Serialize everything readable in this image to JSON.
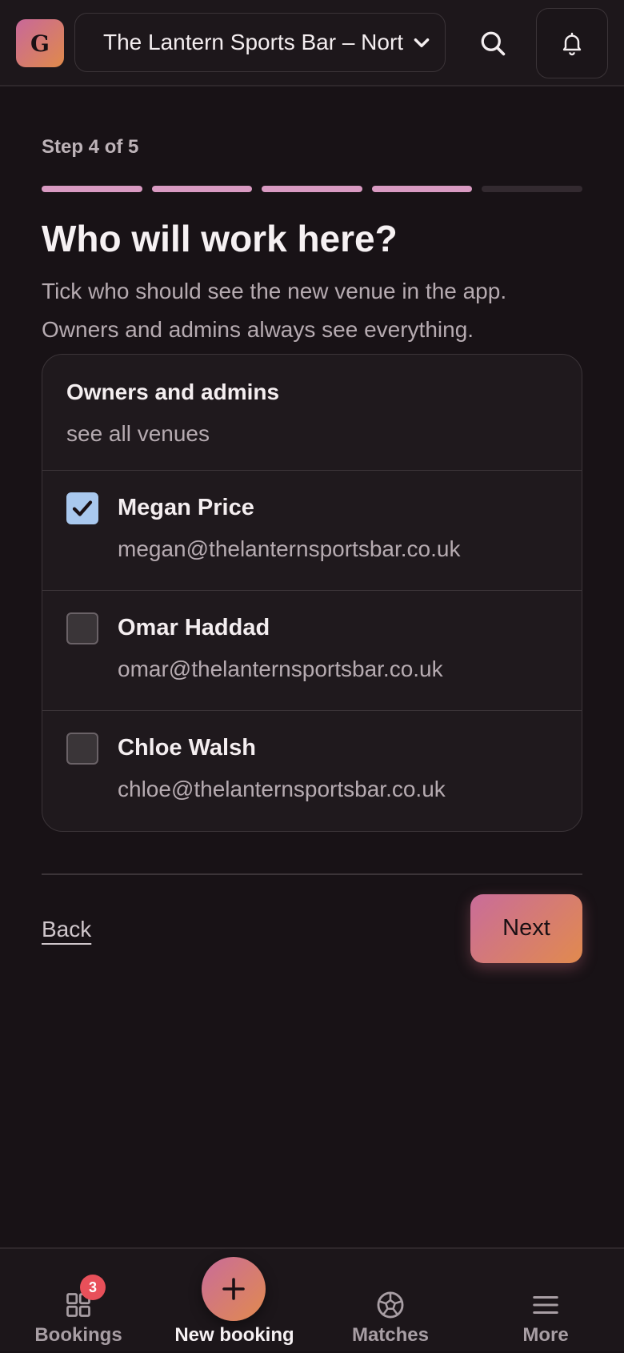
{
  "header": {
    "logo_letter": "G",
    "venue": "The Lantern Sports Bar – North",
    "icons": [
      "chevron-down-icon",
      "search-icon",
      "bell-icon"
    ]
  },
  "wizard": {
    "step_label": "Step 4 of 5",
    "progress": {
      "current": 4,
      "total": 5
    },
    "title": "Who will work here?",
    "subtitle": "Tick who should see the new venue in the app. Owners and admins always see everything."
  },
  "card": {
    "header_title": "Owners and admins",
    "header_subtitle": "see all venues",
    "people": [
      {
        "name": "Megan Price",
        "email": "megan@thelanternsportsbar.co.uk",
        "checked": true
      },
      {
        "name": "Omar Haddad",
        "email": "omar@thelanternsportsbar.co.uk",
        "checked": false
      },
      {
        "name": "Chloe Walsh",
        "email": "chloe@thelanternsportsbar.co.uk",
        "checked": false
      }
    ]
  },
  "actions": {
    "back_label": "Back",
    "next_label": "Next"
  },
  "bottom_nav": {
    "bookings_label": "Bookings",
    "bookings_badge": "3",
    "new_booking_label": "New booking",
    "matches_label": "Matches",
    "more_label": "More"
  },
  "colors": {
    "accent_start": "#c96c9a",
    "accent_end": "#e18a4e",
    "progress_done": "#d99ac2",
    "checkbox_checked": "#a9c8ee",
    "badge": "#e8505a"
  }
}
